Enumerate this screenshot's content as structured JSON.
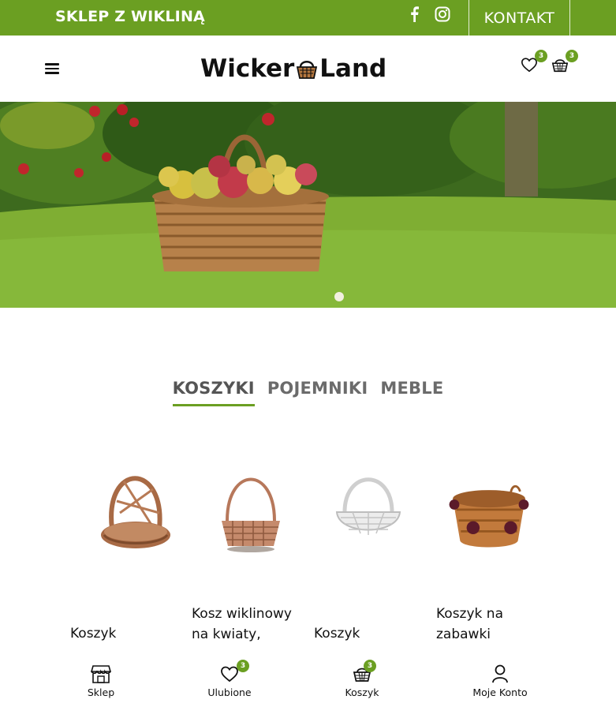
{
  "topbar": {
    "brand": "SKLEP Z WIKLINĄ",
    "contact_label": "KONTAKT",
    "icons": [
      "facebook-icon",
      "instagram-icon"
    ]
  },
  "header": {
    "logo_left": "Wicker",
    "logo_right": "Land",
    "wishlist_count": "3",
    "cart_count": "3",
    "icons": [
      "menu-icon",
      "heart-icon",
      "basket-icon"
    ]
  },
  "hero": {
    "image": "basket-of-apples-and-pears-on-grass"
  },
  "tabs": [
    {
      "label": "KOSZYKI",
      "active": true
    },
    {
      "label": "POJEMNIKI",
      "active": false
    },
    {
      "label": "MEBLE",
      "active": false
    }
  ],
  "products": [
    {
      "name": "Koszyk"
    },
    {
      "name": "Kosz wiklinowy na kwiaty,"
    },
    {
      "name": "Koszyk"
    },
    {
      "name": "Koszyk na zabawki"
    }
  ],
  "bottom_nav": {
    "shop": "Sklep",
    "favorites": "Ulubione",
    "favorites_count": "3",
    "cart": "Koszyk",
    "cart_count": "3",
    "account": "Moje Konto"
  },
  "colors": {
    "accent": "#6b9f22",
    "text": "#111111",
    "tab_inactive": "#6b6b6b"
  }
}
